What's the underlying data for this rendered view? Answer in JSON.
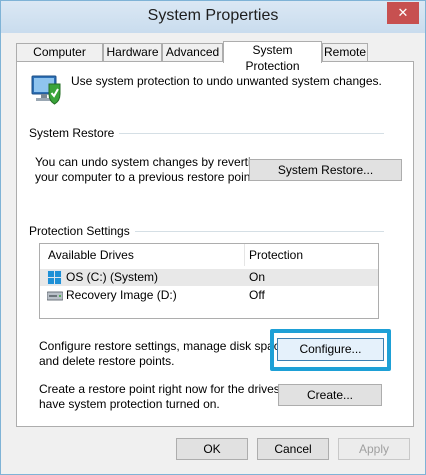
{
  "window": {
    "title": "System Properties",
    "close_glyph": "✕"
  },
  "tabs": [
    {
      "label": "Computer Name"
    },
    {
      "label": "Hardware"
    },
    {
      "label": "Advanced"
    },
    {
      "label": "System Protection",
      "active": true
    },
    {
      "label": "Remote"
    }
  ],
  "intro": {
    "text": "Use system protection to undo unwanted system changes.",
    "icon": "system-protection-icon"
  },
  "system_restore": {
    "group_label": "System Restore",
    "description_line1": "You can undo system changes by reverting",
    "description_line2": "your computer to a previous restore point.",
    "button_label": "System Restore..."
  },
  "protection_settings": {
    "group_label": "Protection Settings",
    "columns": [
      "Available Drives",
      "Protection"
    ],
    "drives": [
      {
        "name": "OS (C:) (System)",
        "protection": "On",
        "icon": "windows-drive-icon"
      },
      {
        "name": "Recovery Image (D:)",
        "protection": "Off",
        "icon": "disk-drive-icon"
      }
    ]
  },
  "configure": {
    "description_line1": "Configure restore settings, manage disk space,",
    "description_line2": "and delete restore points.",
    "button_label": "Configure..."
  },
  "create": {
    "description_line1": "Create a restore point right now for the drives that",
    "description_line2": "have system protection turned on.",
    "button_label": "Create..."
  },
  "footer": {
    "ok": "OK",
    "cancel": "Cancel",
    "apply": "Apply"
  },
  "colors": {
    "focus_ring": "#1ea0d6",
    "close_button": "#c75050",
    "titlebar": "#d3e3f2"
  }
}
